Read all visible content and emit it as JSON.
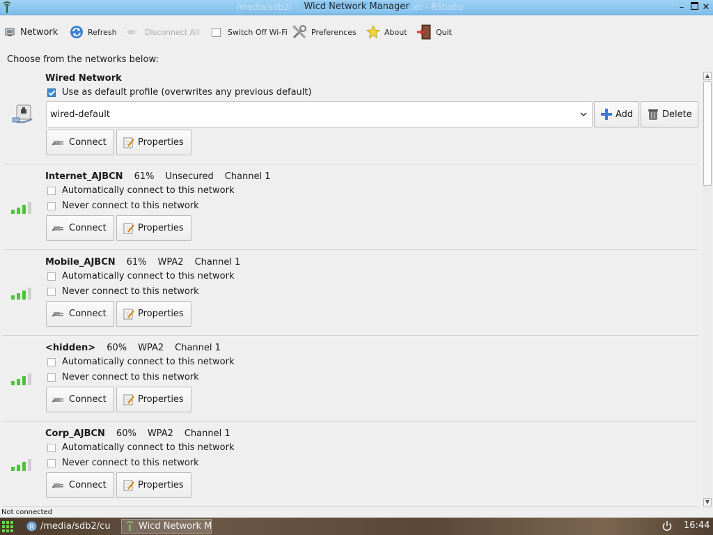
{
  "window": {
    "title": "Wicd Network Manager",
    "behind_title_left": "/media/sdb2/",
    "behind_title_right": "ter - RStudio"
  },
  "toolbar": {
    "network_label": "Network",
    "refresh_label": "Refresh",
    "disconnect_label": "Disconnect All",
    "switch_wifi_label": "Switch Off Wi-Fi",
    "preferences_label": "Preferences",
    "about_label": "About",
    "quit_label": "Quit"
  },
  "choose_label": "Choose from the networks below:",
  "wired": {
    "title": "Wired Network",
    "default_profile_label": "Use as default profile (overwrites any previous default)",
    "default_profile_checked": true,
    "profile_value": "wired-default",
    "add_label": "Add",
    "delete_label": "Delete",
    "connect_label": "Connect",
    "properties_label": "Properties"
  },
  "networks": [
    {
      "name": "Internet_AJBCN",
      "strength": "61%",
      "security": "Unsecured",
      "channel": "Channel 1",
      "auto_label": "Automatically connect to this network",
      "never_label": "Never connect to this network",
      "connect_label": "Connect",
      "properties_label": "Properties"
    },
    {
      "name": "Mobile_AJBCN",
      "strength": "61%",
      "security": "WPA2",
      "channel": "Channel 1",
      "auto_label": "Automatically connect to this network",
      "never_label": "Never connect to this network",
      "connect_label": "Connect",
      "properties_label": "Properties"
    },
    {
      "name": "<hidden>",
      "strength": "60%",
      "security": "WPA2",
      "channel": "Channel 1",
      "auto_label": "Automatically connect to this network",
      "never_label": "Never connect to this network",
      "connect_label": "Connect",
      "properties_label": "Properties"
    },
    {
      "name": "Corp_AJBCN",
      "strength": "60%",
      "security": "WPA2",
      "channel": "Channel 1",
      "auto_label": "Automatically connect to this network",
      "never_label": "Never connect to this network",
      "connect_label": "Connect",
      "properties_label": "Properties"
    }
  ],
  "status": "Not connected",
  "taskbar": {
    "task1": "/media/sdb2/cu",
    "task2": "Wicd Network M",
    "clock": "16:44"
  },
  "colors": {
    "titlebar": "#8cc6ee",
    "signal_green": "#4cc43a",
    "checkbox_checked": "#3b88d0"
  }
}
